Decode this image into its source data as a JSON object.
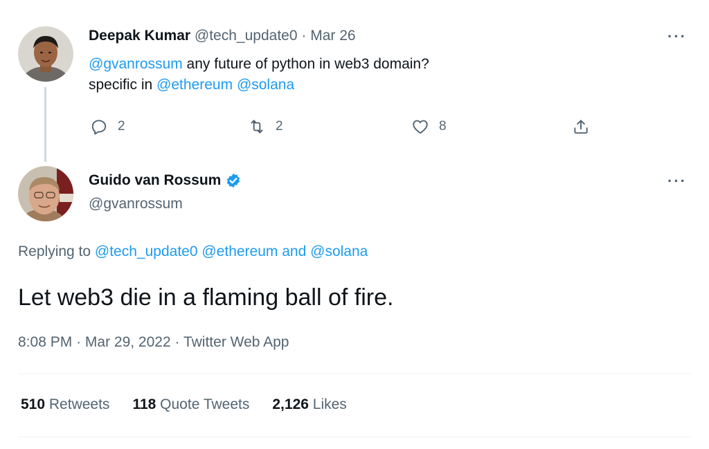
{
  "reply_tweet": {
    "author_name": "Deepak Kumar",
    "author_handle": "@tech_update0",
    "separator": "·",
    "date": "Mar 26",
    "mention_gvanrossum": "@gvanrossum",
    "text_line1_rest": " any future of python in web3 domain?",
    "text_line2_prefix": "specific in ",
    "mention_ethereum": "@ethereum",
    "text_space": " ",
    "mention_solana": "@solana",
    "more_label": "···",
    "actions": {
      "reply_count": "2",
      "retweet_count": "2",
      "like_count": "8"
    }
  },
  "main_tweet": {
    "author_name": "Guido van Rossum",
    "author_handle": "@gvanrossum",
    "verified": true,
    "more_label": "···",
    "replying_to_prefix": "Replying to ",
    "replying_to_user1": "@tech_update0",
    "replying_to_user2": "@ethereum",
    "replying_to_and": " and ",
    "replying_to_user3": "@solana",
    "text": "Let web3 die in a flaming ball of fire.",
    "time": "8:08 PM",
    "separator": "·",
    "date": "Mar 29, 2022",
    "source": "Twitter Web App",
    "stats": {
      "retweets_count": "510",
      "retweets_label": "Retweets",
      "quotes_count": "118",
      "quotes_label": "Quote Tweets",
      "likes_count": "2,126",
      "likes_label": "Likes"
    }
  },
  "colors": {
    "link": "#1d9bf0",
    "muted": "#536471",
    "text": "#0f1419",
    "verified": "#1d9bf0"
  }
}
